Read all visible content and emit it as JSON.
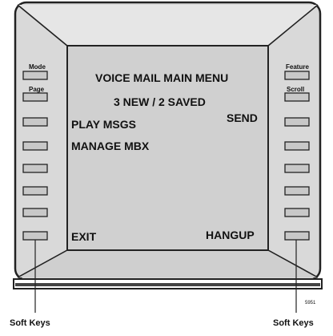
{
  "screen": {
    "title": "VOICE MAIL  MAIN MENU",
    "status": "3 NEW / 2 SAVED",
    "left_options": [
      "PLAY MSGS",
      "MANAGE MBX"
    ],
    "right_options": [
      "SEND"
    ],
    "bottom_left": "EXIT",
    "bottom_right": "HANGUP"
  },
  "left_keys": {
    "top_labels": [
      "Mode",
      "Page"
    ],
    "count": 8
  },
  "right_keys": {
    "top_labels": [
      "Feature",
      "Scroll"
    ],
    "count": 8
  },
  "captions": {
    "left": "Soft Keys",
    "right": "Soft Keys"
  },
  "figure_number": "5951",
  "colors": {
    "bezel": "#d9d9d9",
    "screen": "#d0d0d0",
    "key": "#c8c8c8",
    "stroke": "#222222"
  }
}
